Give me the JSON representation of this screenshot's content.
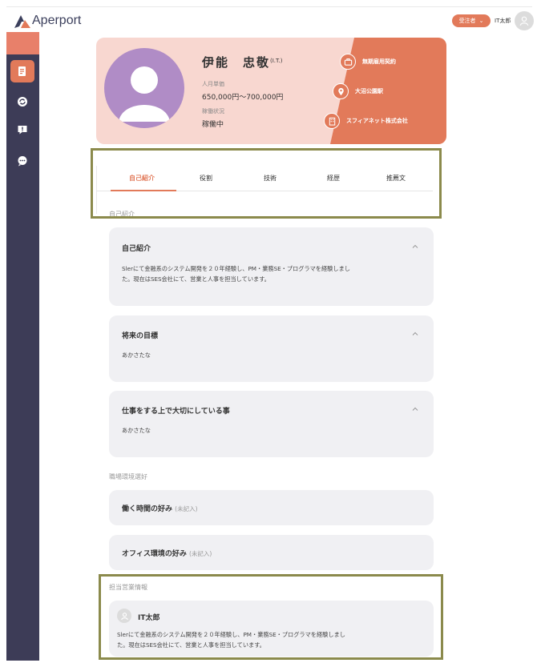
{
  "header": {
    "app_name": "Aperport",
    "role_label": "受注者",
    "user_name": "IT太郎",
    "brand_color": "#e27a5a",
    "nav_color": "#3d3c57"
  },
  "sidebar": {
    "items": [
      {
        "icon": "document-icon",
        "active": true
      },
      {
        "icon": "sync-icon",
        "active": false
      },
      {
        "icon": "chat-alert-icon",
        "active": false
      },
      {
        "icon": "message-icon",
        "active": false
      }
    ]
  },
  "profile": {
    "name": "伊能　忠敬",
    "abbr": "(I.T.)",
    "unit_price_label": "人月単価",
    "unit_price_value": "650,000円〜700,000円",
    "status_label": "稼働状況",
    "status_value": "稼働中",
    "contract": "無期雇用契約",
    "station": "大沼公園駅",
    "company": "スフィアネット株式会社"
  },
  "tabs": [
    {
      "label": "自己紹介",
      "active": true
    },
    {
      "label": "役割",
      "active": false
    },
    {
      "label": "技術",
      "active": false
    },
    {
      "label": "経歴",
      "active": false
    },
    {
      "label": "推薦文",
      "active": false
    }
  ],
  "intro_section": {
    "label": "自己紹介",
    "cards": [
      {
        "title": "自己紹介",
        "lines": [
          "Slerにて金融系のシステム開発を２０年経験し、PM・業務SE・プログラマを経験しまし",
          "た。現在はSES会社にて、営業と人事を担当しています。"
        ]
      },
      {
        "title": "将来の目標",
        "lines": [
          "あかさたな"
        ]
      },
      {
        "title": "仕事をする上で大切にしている事",
        "lines": [
          "あかさたな"
        ]
      }
    ]
  },
  "workplace_section": {
    "label": "職場環境選好",
    "items": [
      {
        "title": "働く時間の好み",
        "note": "(未記入)"
      },
      {
        "title": "オフィス環境の好み",
        "note": "(未記入)"
      }
    ]
  },
  "sales_section": {
    "label": "担当営業情報",
    "name": "IT太郎",
    "lines": [
      "Slerにて金融系のシステム開発を２０年経験し、PM・業務SE・プログラマを経験しまし",
      "た。現在はSES会社にて、営業と人事を担当しています。"
    ]
  }
}
